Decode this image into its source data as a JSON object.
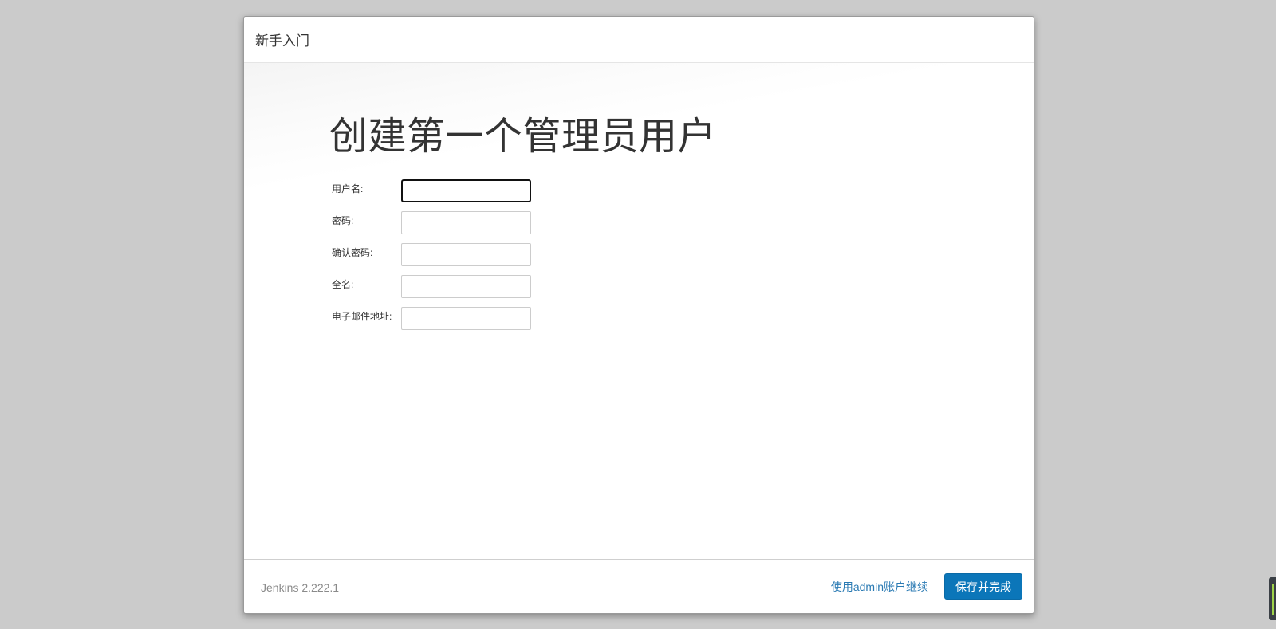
{
  "header": {
    "title": "新手入门"
  },
  "main": {
    "title": "创建第一个管理员用户",
    "fields": [
      {
        "label": "用户名:",
        "value": ""
      },
      {
        "label": "密码:",
        "value": ""
      },
      {
        "label": "确认密码:",
        "value": ""
      },
      {
        "label": "全名:",
        "value": ""
      },
      {
        "label": "电子邮件地址:",
        "value": ""
      }
    ]
  },
  "footer": {
    "version": "Jenkins 2.222.1",
    "continue_label": "使用admin账户继续",
    "save_label": "保存并完成"
  },
  "colors": {
    "primary_button": "#0b76b9",
    "link": "#2a7ab3",
    "backdrop": "#cbcbcb"
  }
}
